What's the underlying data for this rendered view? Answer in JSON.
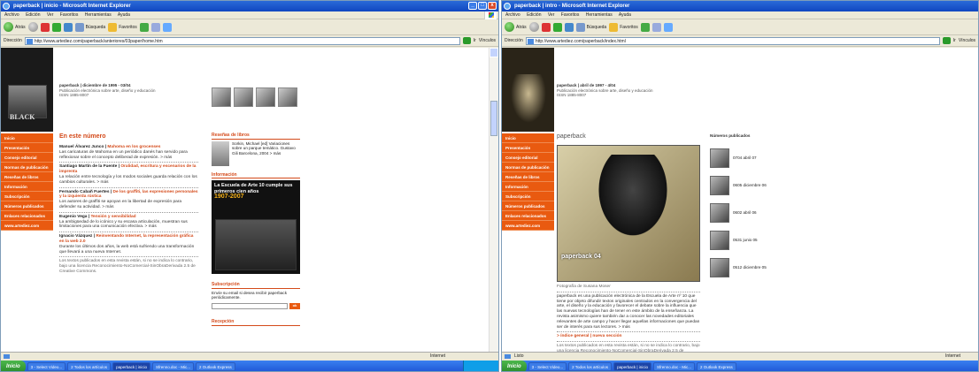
{
  "win1": {
    "title": "paperback | inicio - Microsoft Internet Explorer",
    "menu": [
      "Archivo",
      "Edición",
      "Ver",
      "Favoritos",
      "Herramientas",
      "Ayuda"
    ],
    "toolbar": {
      "back": "Atrás",
      "search": "Búsqueda",
      "favorites": "Favoritos"
    },
    "address_label": "Dirección",
    "url": "http://www.artediez.com/paperback/anteriores/03paper/home.htm",
    "go_label": "Ir",
    "links_label": "Vínculos",
    "header": {
      "line1": "paperback | diciembre de 1995 - 03/04",
      "line2": "Publicación electrónica sobre arte, diseño y educación",
      "line3": "ISSN 1885-8007"
    },
    "logo_text": "BLACK",
    "sidebar": [
      "Inicio",
      "Presentación",
      "Consejo editorial",
      "Normas de publicación",
      "Reseñas de libros",
      "Información",
      "Subscripción",
      "Números publicados",
      "Enlaces relacionados",
      "www.artediez.com"
    ],
    "section_title": "En este número",
    "articles": [
      {
        "author": "Manuel Álvarez Junco",
        "title": "Mahoma en los grocenses",
        "text": "Las caricaturas de Mahoma en un periódico danés han servido para reflexionar sobre el concepto deliberad de expresión. > más"
      },
      {
        "author": "Santiago Martín de la Fuente",
        "title": "Oralidad, escritura y escenarios de la imprenta",
        "text": "La relación entre tecnología y los modos sociales guarda relación con los cambios culturales. > más"
      },
      {
        "author": "Fernando Cabañ Fuertes",
        "title": "De los graffiti, las expresiones personales y la izquierda rústica",
        "text": "Los autores de graffiti se apoyan en la libertad de expresión para defender su actividad. > más"
      },
      {
        "author": "Eugenio Vega",
        "title": "Tensión y sensibilidad",
        "text": "La ambigüedad de lo icónico y su escasa articulación, muestran sus limitaciones para una comunicación efectiva. > más"
      },
      {
        "author": "Ignacio Vázquez",
        "title": "Reinventando Internet, la representación gráfica en la web 2.0",
        "text": "Durante los últimos dos años, la web está sufriendo una transformación que llevará a una nueva Internet."
      }
    ],
    "footer_note": "Los textos publicados en esta revista están, si no se indica lo contrario, bajo una licencia Reconocimiento-NoComercial-SinObraDerivada 2.5 de Creative Commons.",
    "right": {
      "reviews_title": "Reseñas de libros",
      "review": "Sorkin, Michael [ed] Variaciones sobre un parque temático. Gustavo Gili Barcelona, 2004 > más",
      "info_title": "Información",
      "ad_text": "La Escuela de Arte 10 cumple sus primeros cien años",
      "ad_years": "1907-2007",
      "subs_title": "Subscripción",
      "subs_text": "Envíe su email si desea recibir paperback periódicamente.",
      "subs_btn": "ok",
      "rec_title": "Recepción"
    },
    "status": "Internet"
  },
  "win2": {
    "title": "paperback | intro - Microsoft Internet Explorer",
    "menu": [
      "Archivo",
      "Edición",
      "Ver",
      "Favoritos",
      "Herramientas",
      "Ayuda"
    ],
    "toolbar": {
      "back": "Atrás",
      "search": "Búsqueda",
      "favorites": "Favoritos"
    },
    "address_label": "Dirección",
    "url": "http://www.artediez.com/paperback/index.html",
    "go_label": "Ir",
    "links_label": "Vínculos",
    "header": {
      "line1": "paperback | abril de 1997 - 4/04",
      "line2": "Publicación electrónica sobre arte, diseño y educación",
      "line3": "ISSN 1885-8007"
    },
    "section_title": "paperback",
    "cover_label": "paperback 04",
    "photo_credit": "Fotografía de Susana Moser",
    "intro": "paperback es una publicación electrónica de la Escuela de Arte nº 10 que tiene por objeto difundir textos originales centrados en la convergencia del arte, el diseño y la educación y favorecer el debate sobre la influencia que las nuevas tecnologías han de tener en este ámbito de la enseñanza. La revista asimismo quiere también dar a conocer las novedades editoriales relevantes de arte campo y hacer llegar aquellas informaciones que puedan ser de interés para sus lectores. > más",
    "links": "> índice general | nueva sección",
    "footer_note": "Los textos publicados en esta revista están, si no se indica lo contrario, bajo una licencia Reconocimiento-NoComercial-SinObraDerivada 2.5 de Creative.",
    "numbers_title": "Números publicados",
    "numbers": [
      "0704 abril 07",
      "0605 diciembre 06",
      "0602 abril 06",
      "0531 junio 05",
      "0512 diciembre 05"
    ],
    "status_left": "Listo",
    "status": "Internet"
  },
  "taskbar": {
    "start": "Inicio",
    "items": [
      "3 - Select Video...",
      "2 Todos los artículos",
      "paperback | inicio",
      "Sfrenno.doc - Mic...",
      "2 Outlook Express"
    ]
  }
}
